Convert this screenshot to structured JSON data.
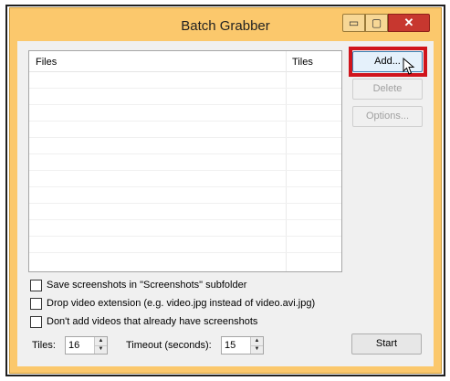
{
  "window": {
    "title": "Batch Grabber",
    "minimize_glyph": "▭",
    "maximize_glyph": "▢",
    "close_glyph": "✕"
  },
  "file_list": {
    "columns": [
      "Files",
      "Tiles"
    ],
    "rows": []
  },
  "buttons": {
    "add": "Add...",
    "delete": "Delete",
    "options": "Options...",
    "start": "Start"
  },
  "options": {
    "save_subfolder": {
      "label": "Save screenshots in \"Screenshots\" subfolder",
      "checked": false
    },
    "drop_extension": {
      "label": "Drop video extension (e.g. video.jpg instead of video.avi.jpg)",
      "checked": false
    },
    "skip_existing": {
      "label": "Don't add videos that already have screenshots",
      "checked": false
    }
  },
  "settings": {
    "tiles_label": "Tiles:",
    "tiles_value": "16",
    "timeout_label": "Timeout (seconds):",
    "timeout_value": "15"
  },
  "colors": {
    "frame": "#fbc86c",
    "close_button": "#c7372f",
    "highlight_box": "#d0141c"
  }
}
